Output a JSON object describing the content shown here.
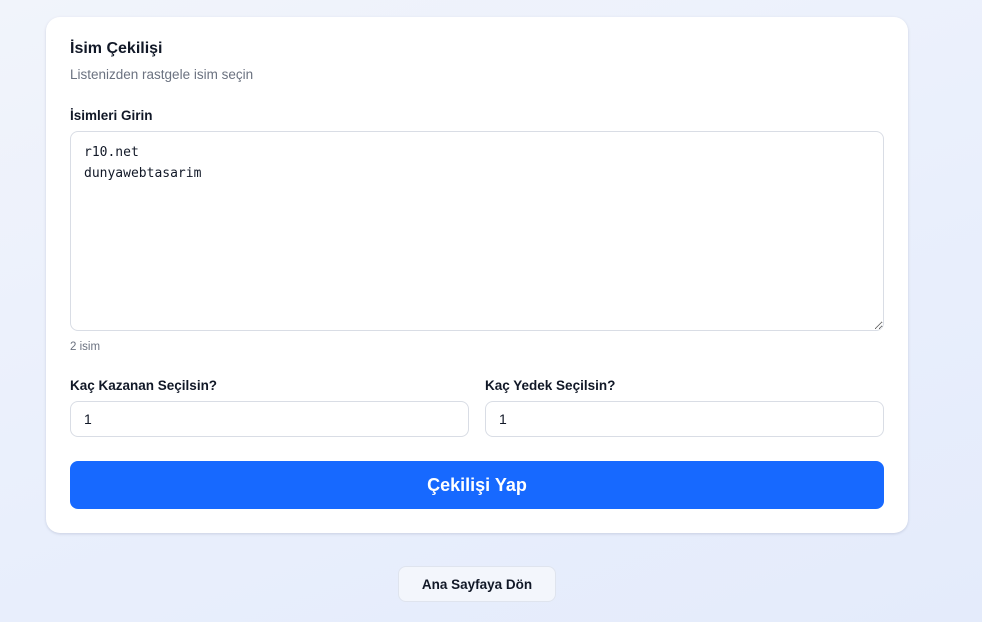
{
  "card": {
    "title": "İsim Çekilişi",
    "subtitle": "Listenizden rastgele isim seçin"
  },
  "names": {
    "label": "İsimleri Girin",
    "value": "r10.net\ndunyawebtasarim",
    "count_text": "2 isim"
  },
  "winners": {
    "label": "Kaç Kazanan Seçilsin?",
    "value": "1"
  },
  "backups": {
    "label": "Kaç Yedek Seçilsin?",
    "value": "1"
  },
  "actions": {
    "draw_label": "Çekilişi Yap",
    "home_label": "Ana Sayfaya Dön"
  },
  "colors": {
    "primary": "#1769ff",
    "background": "#eaeffb"
  }
}
